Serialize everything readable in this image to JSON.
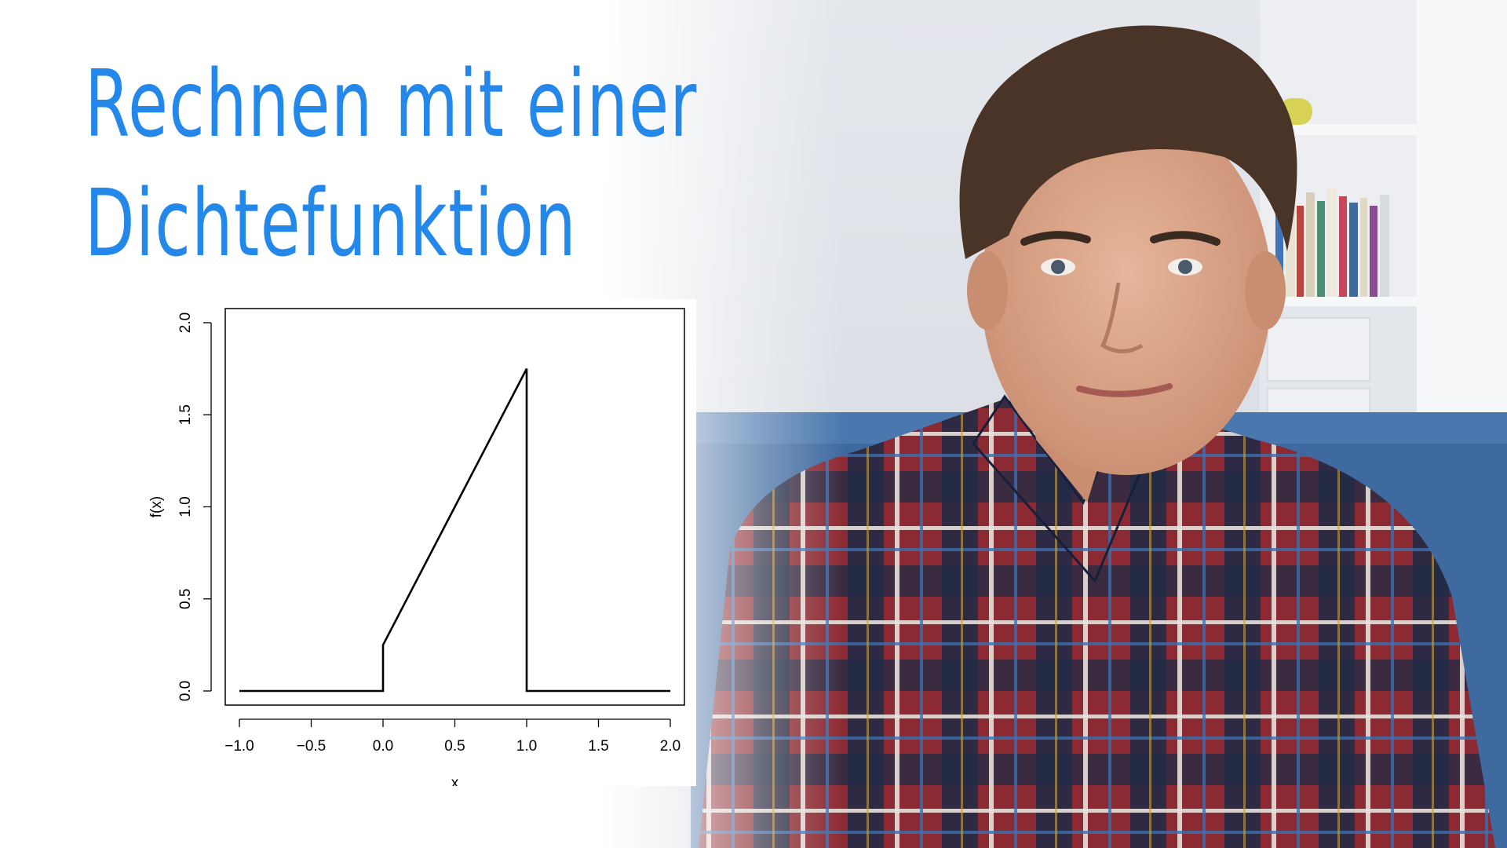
{
  "title_lines": [
    "Rechnen mit einer",
    "Dichtefunktion"
  ],
  "colors": {
    "title": "#2388ea",
    "plot_line": "#000000",
    "frame": "#000000",
    "wall": "#dfe3e8",
    "sofa": "#3f6aa0",
    "shirt_red": "#8c2a33",
    "shirt_navy": "#1f2a45",
    "hair": "#4a3427",
    "skin": "#d9a488"
  },
  "chart_data": {
    "type": "line",
    "title": "",
    "xlabel": "x",
    "ylabel": "f(x)",
    "xlim": [
      -1.0,
      2.0
    ],
    "ylim": [
      0.0,
      2.0
    ],
    "x_ticks": [
      -1.0,
      -0.5,
      0.0,
      0.5,
      1.0,
      1.5,
      2.0
    ],
    "x_tick_labels": [
      "−1.0",
      "−0.5",
      "0.0",
      "0.5",
      "1.0",
      "1.5",
      "2.0"
    ],
    "y_ticks": [
      0.0,
      0.5,
      1.0,
      1.5,
      2.0
    ],
    "y_tick_labels": [
      "0.0",
      "0.5",
      "1.0",
      "1.5",
      "2.0"
    ],
    "grid": false,
    "series": [
      {
        "x": [
          -1.0,
          0.0,
          0.0,
          1.0,
          1.0,
          2.0
        ],
        "y": [
          0.0,
          0.0,
          0.25,
          1.75,
          0.0,
          0.0
        ]
      }
    ]
  }
}
